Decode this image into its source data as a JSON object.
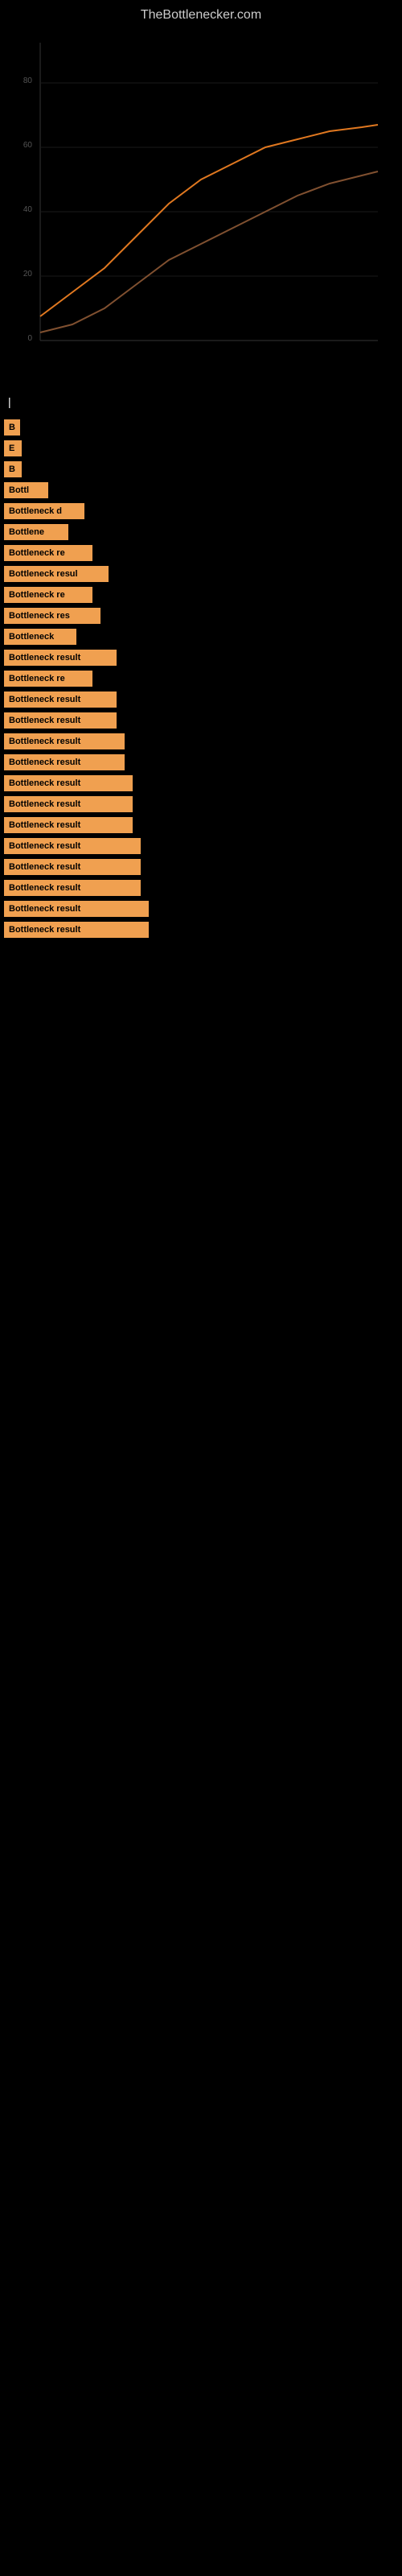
{
  "site": {
    "title": "TheBottlenecker.com"
  },
  "chart": {
    "description": "Bottleneck analysis chart"
  },
  "cursor_indicator": "|",
  "bottleneck_items": [
    {
      "id": 1,
      "label": "B",
      "width_class": "bn-w-20"
    },
    {
      "id": 2,
      "label": "E",
      "width_class": "bn-w-22"
    },
    {
      "id": 3,
      "label": "B",
      "width_class": "bn-w-22"
    },
    {
      "id": 4,
      "label": "Bottl",
      "width_class": "bn-w-55"
    },
    {
      "id": 5,
      "label": "Bottleneck d",
      "width_class": "bn-w-100"
    },
    {
      "id": 6,
      "label": "Bottlene",
      "width_class": "bn-w-80"
    },
    {
      "id": 7,
      "label": "Bottleneck re",
      "width_class": "bn-w-110"
    },
    {
      "id": 8,
      "label": "Bottleneck resul",
      "width_class": "bn-w-130"
    },
    {
      "id": 9,
      "label": "Bottleneck re",
      "width_class": "bn-w-110"
    },
    {
      "id": 10,
      "label": "Bottleneck res",
      "width_class": "bn-w-120"
    },
    {
      "id": 11,
      "label": "Bottleneck",
      "width_class": "bn-w-90"
    },
    {
      "id": 12,
      "label": "Bottleneck result",
      "width_class": "bn-w-140"
    },
    {
      "id": 13,
      "label": "Bottleneck re",
      "width_class": "bn-w-110"
    },
    {
      "id": 14,
      "label": "Bottleneck result",
      "width_class": "bn-w-140"
    },
    {
      "id": 15,
      "label": "Bottleneck result",
      "width_class": "bn-w-140"
    },
    {
      "id": 16,
      "label": "Bottleneck result",
      "width_class": "bn-w-150"
    },
    {
      "id": 17,
      "label": "Bottleneck result",
      "width_class": "bn-w-150"
    },
    {
      "id": 18,
      "label": "Bottleneck result",
      "width_class": "bn-w-160"
    },
    {
      "id": 19,
      "label": "Bottleneck result",
      "width_class": "bn-w-160"
    },
    {
      "id": 20,
      "label": "Bottleneck result",
      "width_class": "bn-w-160"
    },
    {
      "id": 21,
      "label": "Bottleneck result",
      "width_class": "bn-w-170"
    },
    {
      "id": 22,
      "label": "Bottleneck result",
      "width_class": "bn-w-170"
    },
    {
      "id": 23,
      "label": "Bottleneck result",
      "width_class": "bn-w-170"
    },
    {
      "id": 24,
      "label": "Bottleneck result",
      "width_class": "bn-w-180"
    },
    {
      "id": 25,
      "label": "Bottleneck result",
      "width_class": "bn-w-180"
    }
  ]
}
